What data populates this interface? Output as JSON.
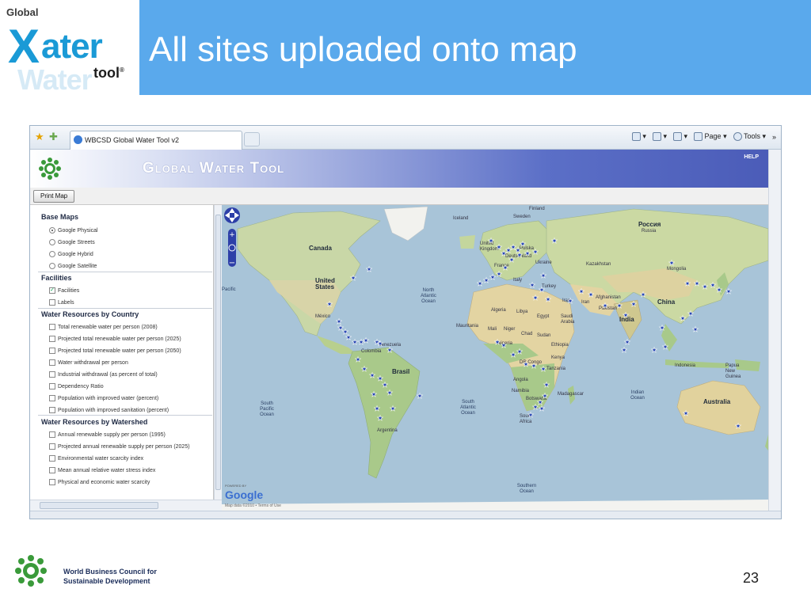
{
  "logo": {
    "line1": "Global",
    "line2": "ater",
    "line3": "tool",
    "mark": "®"
  },
  "slide_title": "All sites uploaded onto map",
  "browser": {
    "tab_title": "WBCSD Global Water Tool v2",
    "tools": {
      "page": "Page",
      "tools": "Tools"
    }
  },
  "app": {
    "title": "Global Water Tool",
    "help": "HELP",
    "print_map": "Print Map"
  },
  "sidebar": {
    "base_maps": {
      "title": "Base Maps",
      "options": [
        {
          "label": "Google Physical",
          "selected": true
        },
        {
          "label": "Google Streets",
          "selected": false
        },
        {
          "label": "Google Hybrid",
          "selected": false
        },
        {
          "label": "Google Satellite",
          "selected": false
        }
      ]
    },
    "facilities": {
      "title": "Facilities",
      "options": [
        {
          "label": "Facilities",
          "checked": true
        },
        {
          "label": "Labels",
          "checked": false
        }
      ]
    },
    "by_country": {
      "title": "Water Resources by Country",
      "options": [
        "Total renewable water per person (2008)",
        "Projected total renewable water per person (2025)",
        "Projected total renewable water per person (2050)",
        "Water withdrawal per person",
        "Industrial withdrawal (as percent of total)",
        "Dependency Ratio",
        "Population with improved water (percent)",
        "Population with improved sanitation (percent)"
      ]
    },
    "by_watershed": {
      "title": "Water Resources by Watershed",
      "options": [
        "Annual renewable supply per person (1995)",
        "Projected annual renewable supply per person (2025)",
        "Environmental water scarcity index",
        "Mean annual relative water stress index",
        "Physical and economic water scarcity"
      ]
    }
  },
  "map": {
    "big_labels": {
      "canada": "Canada",
      "united_states": "United States",
      "brasil": "Brasil",
      "australia": "Australia",
      "china": "China",
      "india": "India",
      "russia": "Россия",
      "russia_en": "Russia",
      "kazakhstan": "Kazakhstan",
      "argentina": "Argentina"
    },
    "ocean_labels": {
      "north_atlantic": "North Atlantic Ocean",
      "south_pacific": "South Pacific Ocean",
      "south_atlantic": "South Atlantic Ocean",
      "indian": "Indian Ocean",
      "southern": "Southern Ocean",
      "pacific": "Pacific"
    },
    "country_labels": {
      "algeria": "Algeria",
      "libya": "Libya",
      "egypt": "Egypt",
      "mali": "Mali",
      "niger": "Niger",
      "chad": "Chad",
      "sudan": "Sudan",
      "ethiopia": "Ethiopia",
      "nigeria": "Nigeria",
      "dr_congo": "DR Congo",
      "kenya": "Kenya",
      "tanzania": "Tanzania",
      "angola": "Angola",
      "namibia": "Namibia",
      "botswana": "Botswana",
      "madagascar": "Madagascar",
      "south_africa": "South Africa",
      "mauritania": "Mauritania",
      "saudi": "Saudi Arabia",
      "iraq": "Iraq",
      "iran": "Iran",
      "afghanistan": "Afghanistan",
      "pakistan": "Pakistan",
      "mongolia": "Mongolia",
      "indonesia": "Indonesia",
      "png": "Papua New Guinea",
      "colombia": "Colombia",
      "venezuela": "Venezuela",
      "mexico": "México",
      "turkey": "Turkey",
      "ukraine": "Ukraine",
      "finland": "Finland",
      "sweden": "Sweden",
      "uk": "United Kingdom",
      "iceland": "Iceland",
      "poland": "Polska",
      "france": "France",
      "italy": "Italy",
      "germany": "Deutschland"
    },
    "google": "Google",
    "powered_by": "POWERED BY",
    "map_data": "Map data ©2010 • Terms of Use"
  },
  "footer": {
    "org_line1": "World Business Council for",
    "org_line2": "Sustainable Development",
    "page_number": "23"
  },
  "colors": {
    "title_bar": "#5aa9ec",
    "logo_blue": "#1a9ad6",
    "app_header": "#4b5cb8",
    "marker": "#1f3fb0"
  }
}
